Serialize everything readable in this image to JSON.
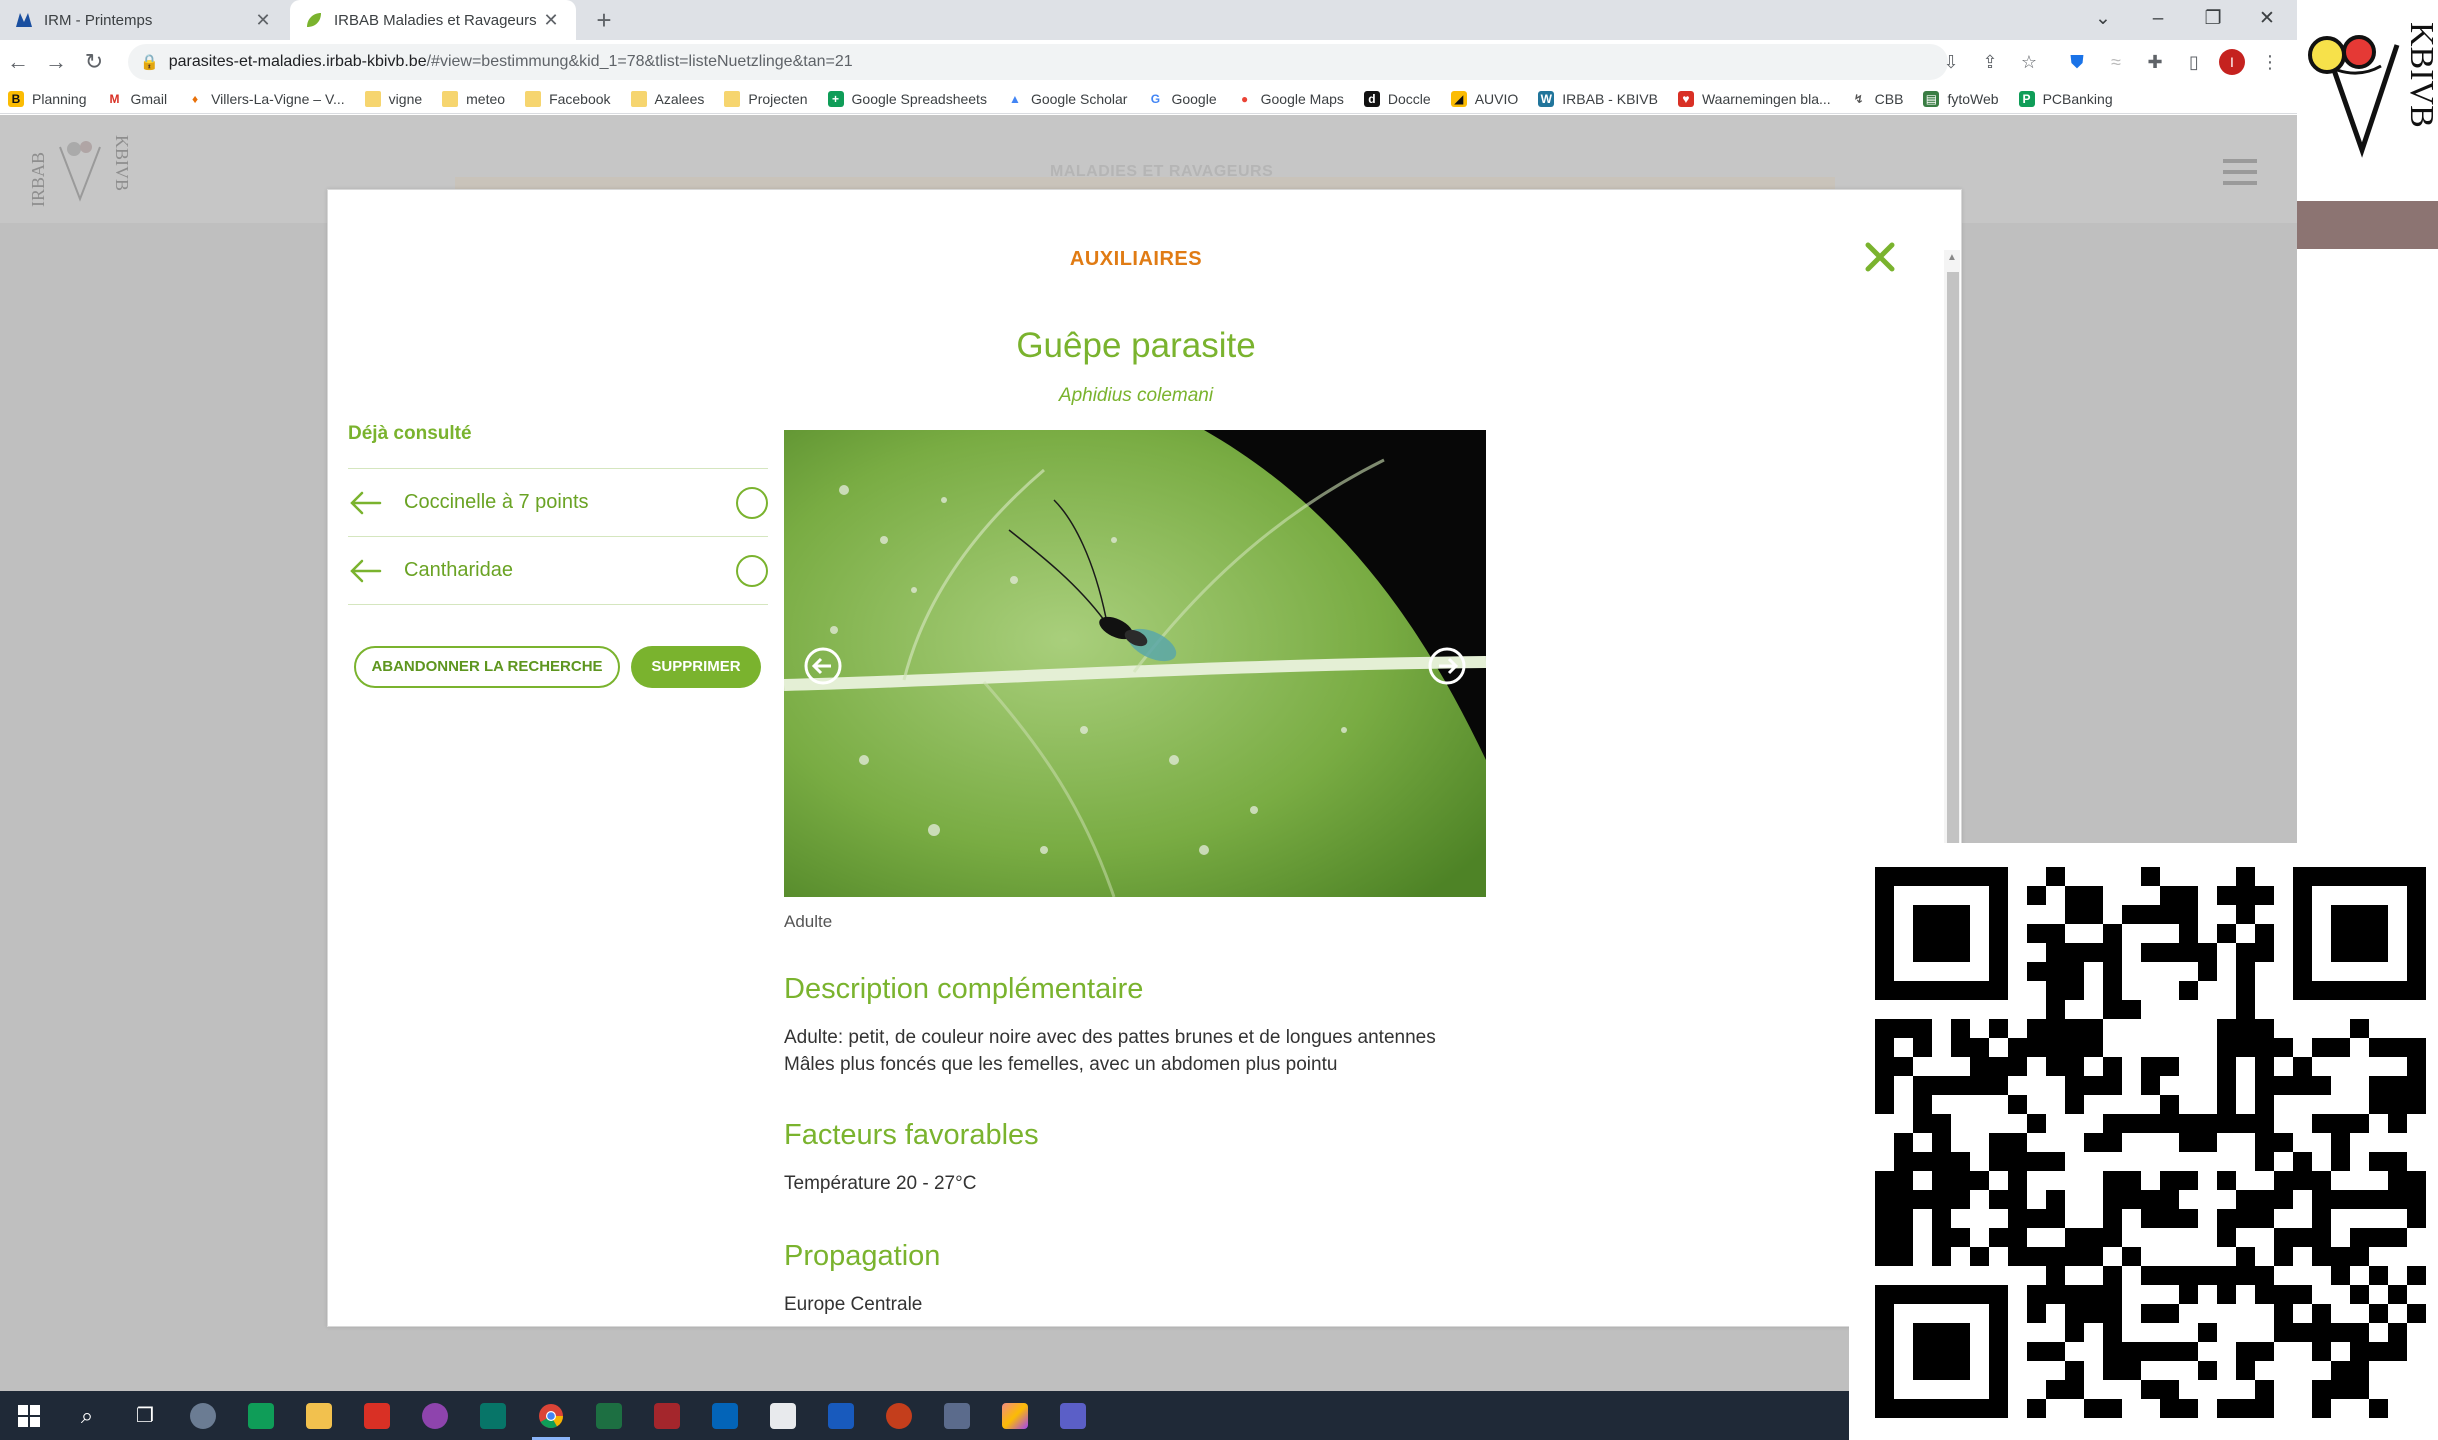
{
  "browser": {
    "tabs": [
      {
        "title": "IRM - Printemps",
        "active": false
      },
      {
        "title": "IRBAB Maladies et Ravageurs",
        "active": true
      }
    ],
    "url_host": "parasites-et-maladies.irbab-kbivb.be",
    "url_path": "/#view=bestimmung&kid_1=78&tlist=listeNuetzlinge&tan=21",
    "profile_initial": "I",
    "bookmarks": [
      {
        "label": "Planning",
        "icon": "b-icon"
      },
      {
        "label": "Gmail",
        "icon": "gmail-icon"
      },
      {
        "label": "Villers-La-Vigne – V...",
        "icon": "pin-icon"
      },
      {
        "label": "vigne",
        "icon": "folder-icon"
      },
      {
        "label": "meteo",
        "icon": "folder-icon"
      },
      {
        "label": "Facebook",
        "icon": "folder-icon"
      },
      {
        "label": "Azalees",
        "icon": "folder-icon"
      },
      {
        "label": "Projecten",
        "icon": "folder-icon"
      },
      {
        "label": "Google Spreadsheets",
        "icon": "sheets-icon"
      },
      {
        "label": "Google Scholar",
        "icon": "scholar-icon"
      },
      {
        "label": "Google",
        "icon": "google-icon"
      },
      {
        "label": "Google Maps",
        "icon": "maps-icon"
      },
      {
        "label": "Doccle",
        "icon": "doccle-icon"
      },
      {
        "label": "AUVIO",
        "icon": "auvio-icon"
      },
      {
        "label": "IRBAB - KBIVB",
        "icon": "wordpress-icon"
      },
      {
        "label": "Waarnemingen bla...",
        "icon": "waarnemingen-icon"
      },
      {
        "label": "CBB",
        "icon": "cbb-icon"
      },
      {
        "label": "fytoWeb",
        "icon": "fytoweb-icon"
      },
      {
        "label": "PCBanking",
        "icon": "pcbanking-icon"
      }
    ]
  },
  "site": {
    "logo_left": "IRBAB",
    "logo_right": "KBIVB",
    "header_text": "MALADIES ET RAVAGEURS"
  },
  "modal": {
    "category": "AUXILIAIRES",
    "species_name": "Guêpe parasite",
    "latin_name": "Aphidius colemani",
    "visited_title": "Déjà consulté",
    "visited_items": [
      {
        "label": "Coccinelle à 7 points"
      },
      {
        "label": "Cantharidae"
      }
    ],
    "abandon_label": "ABANDONNER LA RECHERCHE",
    "delete_label": "SUPPRIMER",
    "image_caption": "Adulte",
    "sections": [
      {
        "heading": "Description complémentaire",
        "lines": [
          "Adulte: petit, de couleur noire avec des pattes brunes et de longues antennes",
          "Mâles plus foncés que les femelles, avec un abdomen plus pointu"
        ]
      },
      {
        "heading": "Facteurs favorables",
        "lines": [
          "Température 20 - 27°C"
        ]
      },
      {
        "heading": "Propagation",
        "lines": [
          "Europe Centrale"
        ]
      }
    ]
  },
  "overlay": {
    "brand": "KBIVB"
  },
  "colors": {
    "accent_green": "#7ab32e",
    "category_orange": "#e07b14"
  }
}
